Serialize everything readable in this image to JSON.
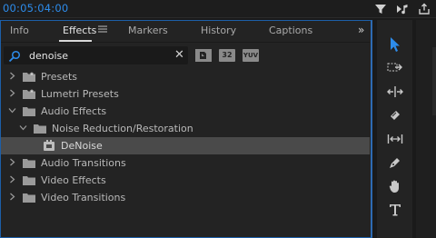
{
  "header": {
    "timecode": "00:05:04:00"
  },
  "panel": {
    "tabs": [
      {
        "label": "Info",
        "active": false
      },
      {
        "label": "Effects",
        "active": true
      },
      {
        "label": "Markers",
        "active": false
      },
      {
        "label": "History",
        "active": false
      },
      {
        "label": "Captions",
        "active": false
      }
    ],
    "tab_menu_icon": "hamburger-icon",
    "overflow_icon": "double-chevron-right-icon",
    "search": {
      "value": "denoise",
      "placeholder": ""
    },
    "filters": [
      {
        "label": "",
        "icon": "accelerated-effects-icon"
      },
      {
        "label": "32",
        "icon": "32-bit-color-icon"
      },
      {
        "label": "YUV",
        "icon": "yuv-effects-icon"
      }
    ],
    "tree": [
      {
        "label": "Presets",
        "state": "collapsed",
        "icon": "folder-star-icon"
      },
      {
        "label": "Lumetri Presets",
        "state": "collapsed",
        "icon": "folder-star-icon"
      },
      {
        "label": "Audio Effects",
        "state": "expanded",
        "icon": "folder-icon"
      },
      {
        "label": "Noise Reduction/Restoration",
        "state": "expanded",
        "icon": "folder-icon"
      },
      {
        "label": "DeNoise",
        "state": "selected",
        "icon": "effect-icon"
      },
      {
        "label": "Audio Transitions",
        "state": "collapsed",
        "icon": "folder-icon"
      },
      {
        "label": "Video Effects",
        "state": "collapsed",
        "icon": "folder-icon"
      },
      {
        "label": "Video Transitions",
        "state": "collapsed",
        "icon": "folder-icon"
      }
    ]
  },
  "tools": [
    "selection-tool-icon",
    "track-select-tool-icon",
    "ripple-edit-tool-icon",
    "razor-tool-icon",
    "slip-tool-icon",
    "pen-tool-icon",
    "hand-tool-icon",
    "type-tool-icon"
  ],
  "colors": {
    "accent": "#2d8ceb",
    "panel_border": "#1d5fa8",
    "selected_row": "#4a4a4a",
    "folder": "#9a9a9a"
  }
}
